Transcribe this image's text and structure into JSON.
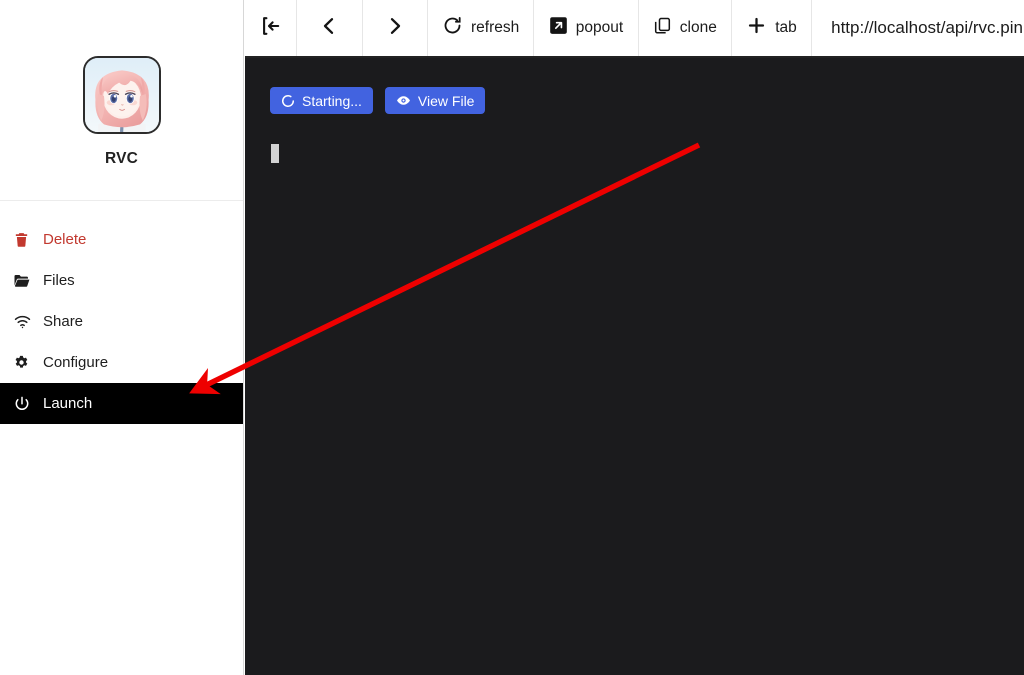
{
  "sidebar": {
    "app_title": "RVC",
    "avatar_icon": "anime-character-avatar",
    "menu": [
      {
        "label": "Delete",
        "icon": "trash-icon",
        "style": "danger",
        "active": false
      },
      {
        "label": "Files",
        "icon": "folder-open-icon",
        "style": "normal",
        "active": false
      },
      {
        "label": "Share",
        "icon": "wifi-share-icon",
        "style": "normal",
        "active": false
      },
      {
        "label": "Configure",
        "icon": "gear-icon",
        "style": "normal",
        "active": false
      },
      {
        "label": "Launch",
        "icon": "power-icon",
        "style": "normal",
        "active": true
      }
    ]
  },
  "toolbar": {
    "collapse_icon": "collapse-sidebar-icon",
    "back_icon": "chevron-left-icon",
    "forward_icon": "chevron-right-icon",
    "refresh_label": "refresh",
    "refresh_icon": "refresh-icon",
    "popout_label": "popout",
    "popout_icon": "popout-icon",
    "clone_label": "clone",
    "clone_icon": "clone-icon",
    "tab_label": "tab",
    "tab_icon": "plus-icon",
    "url": "http://localhost/api/rvc.pin"
  },
  "content": {
    "starting_button_label": "Starting...",
    "starting_button_icon": "spinner-icon",
    "view_file_button_label": "View File",
    "view_file_button_icon": "eye-icon",
    "terminal_cursor": "block-cursor"
  },
  "annotation": {
    "arrow_color": "#ee0000",
    "arrow_target": "Launch"
  },
  "colors": {
    "accent_blue": "#4263e0",
    "terminal_background": "#1b1b1d",
    "danger_red": "#c2392f",
    "active_item_background": "#000000",
    "annotation_red": "#ee0000"
  }
}
